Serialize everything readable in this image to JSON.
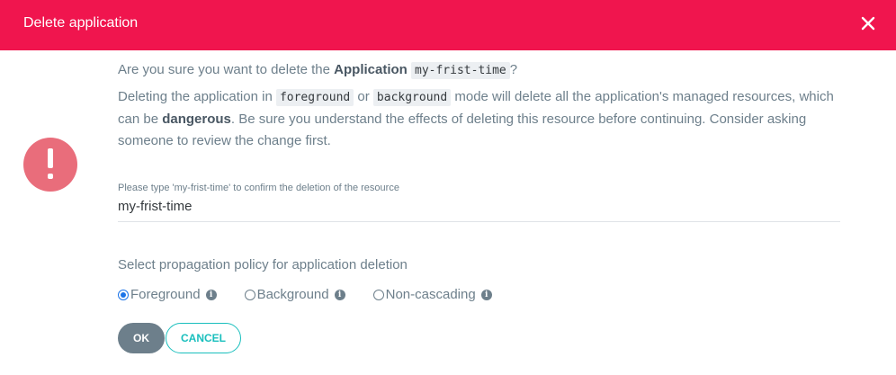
{
  "dialog": {
    "title": "Delete application",
    "close_icon": "close-icon",
    "alert_icon": "exclamation-icon"
  },
  "question": {
    "prefix": "Are you sure you want to delete the ",
    "entity": "Application",
    "app_name": "my-frist-time",
    "suffix": "?"
  },
  "description": {
    "part1": "Deleting the application in ",
    "code1": "foreground",
    "part2": " or ",
    "code2": "background",
    "part3": " mode will delete all the application's managed resources, which can be ",
    "bold": "dangerous",
    "part4": ". Be sure you understand the effects of deleting this resource before continuing. Consider asking someone to review the change first."
  },
  "confirm_field": {
    "label": "Please type 'my-frist-time' to confirm the deletion of the resource",
    "value": "my-frist-time"
  },
  "propagation": {
    "label": "Select propagation policy for application deletion",
    "options": [
      {
        "label": "Foreground",
        "selected": true
      },
      {
        "label": "Background",
        "selected": false
      },
      {
        "label": "Non-cascading",
        "selected": false
      }
    ]
  },
  "buttons": {
    "ok": "OK",
    "cancel": "CANCEL"
  },
  "colors": {
    "header": "#f0154e",
    "alert": "#e96d7b",
    "accent": "#19bfbd",
    "text": "#6d7f8b"
  }
}
